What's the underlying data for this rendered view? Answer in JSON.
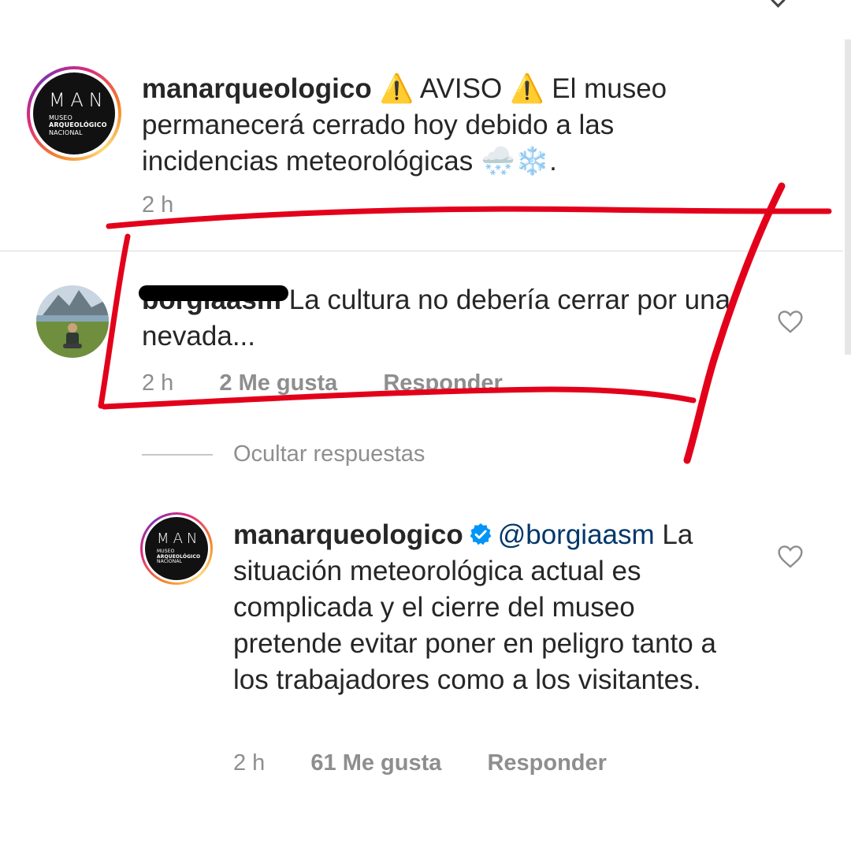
{
  "post": {
    "username": "manarqueologico",
    "text": "AVISO ⚠️ El museo permanecerá cerrado hoy debido a las incidencias meteorológicas 🌨️❄️.",
    "lead_emoji": "⚠️",
    "time": "2 h",
    "avatar": {
      "logo_big": "MAN",
      "logo_line1": "Museo",
      "logo_line2": "Arqueológico",
      "logo_line3": "Nacional"
    }
  },
  "comment": {
    "username": "borgiaasm",
    "text": "La cultura no debería cerrar por una nevada...",
    "time": "2 h",
    "likes": "2 Me gusta",
    "reply": "Responder",
    "avatar_icon": "user-photo-avatar"
  },
  "hide_replies_label": "Ocultar respuestas",
  "reply": {
    "username": "manarqueologico",
    "mention": "@borgiaasm",
    "text": "La situación meteorológica actual es complicada y el cierre del museo pretende evitar poner en peligro tanto a los trabajadores como a los visitantes.",
    "time": "2 h",
    "likes": "61 Me gusta",
    "reply": "Responder",
    "avatar": {
      "logo_big": "MAN",
      "logo_line1": "Museo",
      "logo_line2": "Arqueológico",
      "logo_line3": "Nacional"
    }
  },
  "colors": {
    "text": "#262626",
    "secondary": "#8e8e8e",
    "mention": "#00376b",
    "verified": "#0095f6",
    "annotation": "#e3001b"
  }
}
